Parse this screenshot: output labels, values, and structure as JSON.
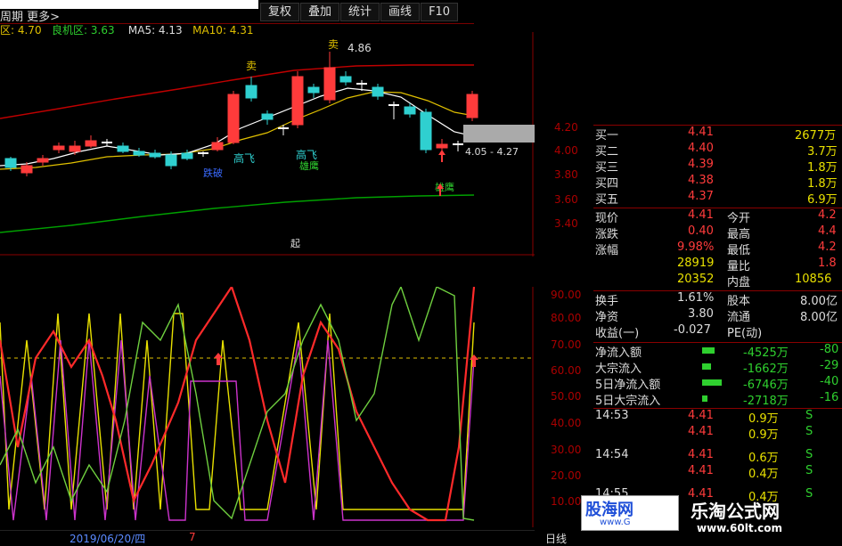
{
  "toolbar": {
    "title": "周期 更多>",
    "buttons": [
      "复权",
      "叠加",
      "统计",
      "画线",
      "F10"
    ]
  },
  "indicators_row": {
    "label1": "区: 4.70",
    "label2": "良机区: 3.63",
    "ma5": "MA5: 4.13",
    "ma10": "MA10: 4.31"
  },
  "kline": {
    "price_labels": [
      "4.20",
      "4.00",
      "3.80",
      "3.60",
      "3.40"
    ],
    "high_label": "4.86",
    "range_label": "4.05 - 4.27",
    "tags": {
      "sell1": "卖",
      "sell2": "卖",
      "gaofei1": "高飞",
      "gaofei2": "高飞",
      "xiongying1": "雄鹰",
      "xiongying2": "雄鹰",
      "dipick": "跌破",
      "bottom_mark": "起"
    },
    "zero_label": "00"
  },
  "indicator": {
    "labels": [
      "90.00",
      "80.00",
      "70.00",
      "60.00",
      "50.00",
      "40.00",
      "30.00",
      "20.00",
      "10.00"
    ]
  },
  "quote": {
    "bids": [
      {
        "label": "买一",
        "price": "4.41",
        "vol": "2677万"
      },
      {
        "label": "买二",
        "price": "4.40",
        "vol": "3.7万"
      },
      {
        "label": "买三",
        "price": "4.39",
        "vol": "1.8万"
      },
      {
        "label": "买四",
        "price": "4.38",
        "vol": "1.8万"
      },
      {
        "label": "买五",
        "price": "4.37",
        "vol": "6.9万"
      }
    ],
    "stats": [
      {
        "l1": "现价",
        "v1": "4.41",
        "l2": "今开",
        "v2": "4.2"
      },
      {
        "l1": "涨跌",
        "v1": "0.40",
        "l2": "最高",
        "v2": "4.4"
      },
      {
        "l1": "涨幅",
        "v1": "9.98%",
        "l2": "最低",
        "v2": "4.2"
      },
      {
        "l1": "",
        "v1": "28919",
        "l2": "量比",
        "v2": "1.8"
      },
      {
        "l1": "",
        "v1": "20352",
        "l2": "内盘",
        "v2": "10856"
      }
    ],
    "fundamentals": [
      {
        "l1": "换手",
        "v1": "1.61%",
        "l2": "股本",
        "v2": "8.00亿"
      },
      {
        "l1": "净资",
        "v1": "3.80",
        "l2": "流通",
        "v2": "8.00亿"
      },
      {
        "l1": "收益(一)",
        "v1": "-0.027",
        "l2": "PE(动)",
        "v2": ""
      }
    ],
    "flows": [
      {
        "label": "净流入额",
        "value": "-4525万",
        "pct": "-80"
      },
      {
        "label": "大宗流入",
        "value": "-1662万",
        "pct": "-29"
      },
      {
        "label": "5日净流入额",
        "value": "-6746万",
        "pct": "-40"
      },
      {
        "label": "5日大宗流入",
        "value": "-2718万",
        "pct": "-16"
      }
    ],
    "ticks": [
      {
        "time": "14:53",
        "price": "4.41",
        "vol": "0.9万",
        "side": "S"
      },
      {
        "time": "",
        "price": "4.41",
        "vol": "0.9万",
        "side": "S"
      },
      {
        "time": "14:54",
        "price": "4.41",
        "vol": "0.6万",
        "side": "S"
      },
      {
        "time": "",
        "price": "4.41",
        "vol": "0.4万",
        "side": "S"
      },
      {
        "time": "14:55",
        "price": "4.41",
        "vol": "0.4万",
        "side": "S"
      }
    ]
  },
  "bottom": {
    "date": "2019/06/20/四",
    "marker": "7",
    "day_label": "日线"
  },
  "branding": {
    "logo_left_title": "股海网",
    "logo_left_url": "www.G",
    "logo_right_title": "乐淘公式网",
    "logo_right_url": "www.60lt.com"
  },
  "colors": {
    "up": "#ff3b3b",
    "down": "#2fd0d0",
    "ma5": "#ffffff",
    "ma10": "#e0c000",
    "long_red": "#c00000",
    "long_green": "#00a000"
  }
}
